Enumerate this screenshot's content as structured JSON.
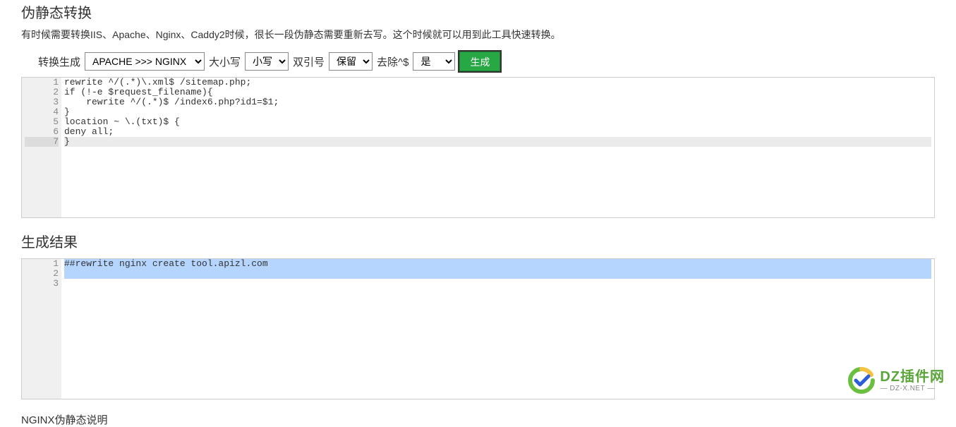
{
  "header": {
    "title": "伪静态转换",
    "description": "有时候需要转换IIS、Apache、Nginx、Caddy2时候，很长一段伪静态需要重新去写。这个时候就可以用到此工具快速转换。"
  },
  "controls": {
    "convert_label": "转换生成",
    "convert_selected": "APACHE >>> NGINX",
    "case_label": "大小写",
    "case_selected": "小写",
    "quote_label": "双引号",
    "quote_selected": "保留",
    "strip_label": "去除^$",
    "strip_selected": "是",
    "generate_button": "生成"
  },
  "input_editor": {
    "lines": [
      "rewrite ^/(.*)\\.xml$ /sitemap.php;",
      "if (!-e $request_filename){",
      "    rewrite ^/(.*)$ /index6.php?id1=$1;",
      "}",
      "location ~ \\.(txt)$ {",
      "deny all;",
      "}"
    ],
    "active_line_index": 6
  },
  "result": {
    "title": "生成结果",
    "lines": [
      "##rewrite nginx create tool.apizl.com",
      "",
      ""
    ],
    "selected_lines": [
      0,
      1
    ]
  },
  "footer": {
    "note": "NGINX伪静态说明"
  },
  "watermark": {
    "main": "DZ插件网",
    "sub": "— DZ-X.NET —"
  }
}
